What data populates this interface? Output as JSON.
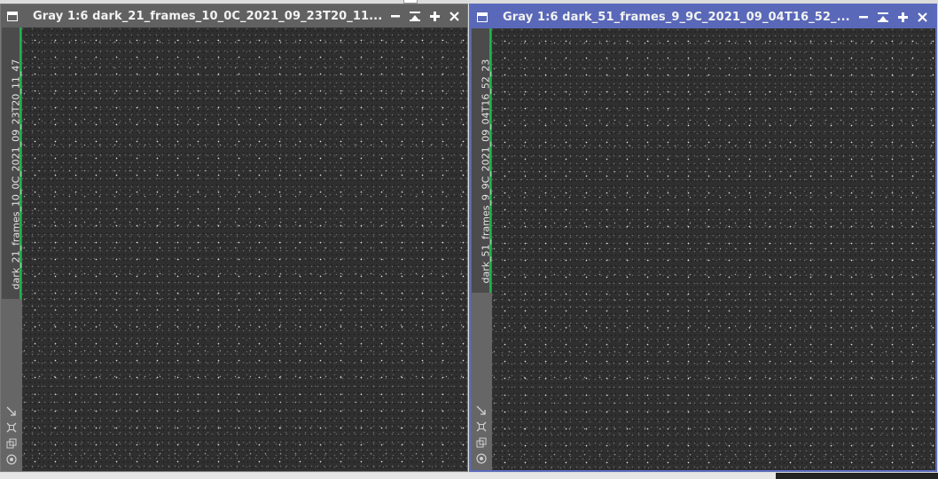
{
  "windows": [
    {
      "title": "Gray 1:6 dark_21_frames_10_0C_2021_09_23T20_11...",
      "view_id": "dark_21_frames_10_0C_2021_09_23T20_11_47",
      "active": false
    },
    {
      "title": "Gray 1:6 dark_51_frames_9_9C_2021_09_04T16_52_...",
      "view_id": "dark_51_frames_9_9C_2021_09_04T16_52_23",
      "active": true
    }
  ],
  "controls": {
    "minimize": "−",
    "shade": "⌅",
    "maximize": "+",
    "close": "✕"
  },
  "icons": [
    "window-icon",
    "minimize-icon",
    "shade-icon",
    "maximize-icon",
    "close-icon",
    "fit-view-icon",
    "zoom-icon",
    "clone-icon",
    "target-icon"
  ],
  "colors": {
    "active_titlebar": "#5968b8",
    "inactive_titlebar": "#616161",
    "view_tab_accent": "#22b14c",
    "canvas": "#2f2f2f"
  }
}
